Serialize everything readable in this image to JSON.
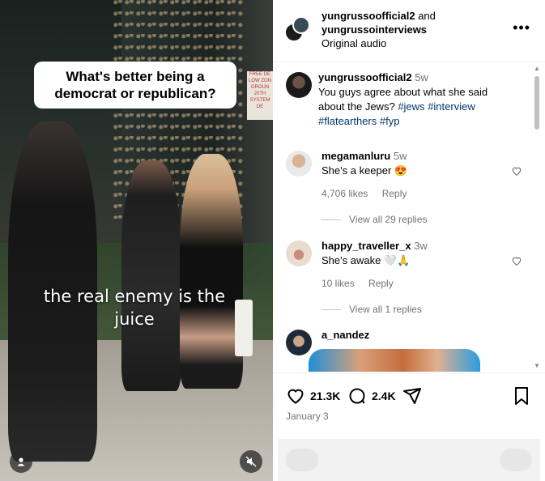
{
  "video": {
    "caption": "What's better being a democrat or republican?",
    "subtitle": "the real enemy is the juice",
    "sign_text": [
      "FREE DE",
      "LOW ZON",
      "GROUN",
      "20TH",
      "SYSTEM DE"
    ]
  },
  "post_header": {
    "user1": "yungrussoofficial2",
    "and_text": "and",
    "user2": "yungrussointerviews",
    "audio": "Original audio"
  },
  "comments": [
    {
      "username": "yungrussoofficial2",
      "time": "5w",
      "text": "You guys agree about what she said about the Jews?",
      "tags": [
        "#jews",
        "#interview",
        "#flatearthers",
        "#fyp"
      ]
    },
    {
      "username": "megamanluru",
      "time": "5w",
      "text": "She's a keeper 😍",
      "likes": "4,706 likes",
      "reply_label": "Reply",
      "view_replies": "View all 29 replies"
    },
    {
      "username": "happy_traveller_x",
      "time": "3w",
      "text": "She's awake 🤍🙏",
      "likes": "10 likes",
      "reply_label": "Reply",
      "view_replies": "View all 1 replies"
    },
    {
      "username": "a_nandez"
    }
  ],
  "actions": {
    "likes_count": "21.3K",
    "comments_count": "2.4K",
    "date": "January 3"
  },
  "colors": {
    "link": "#00376b",
    "muted": "#737373"
  }
}
